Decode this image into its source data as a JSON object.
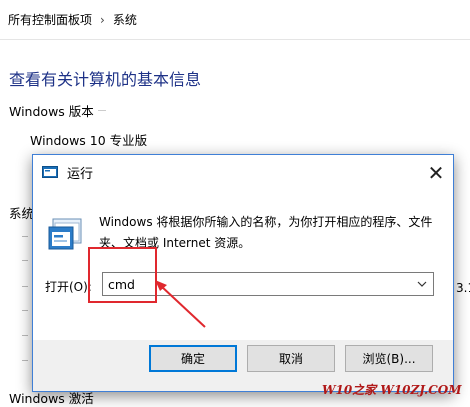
{
  "breadcrumb": {
    "root": "所有控制面板项",
    "separator": "›",
    "current": "系统"
  },
  "page": {
    "title": "查看有关计算机的基本信息",
    "windows_edition_heading": "Windows 版本",
    "edition": "Windows 10 专业版",
    "system_heading_fragment": "系统",
    "number_fragment": "3.1",
    "bottom_heading_fragment": "Windows 激活"
  },
  "run_dialog": {
    "title": "运行",
    "close_glyph": "✕",
    "description": "Windows 将根据你所输入的名称，为你打开相应的程序、文件夹、文档或 Internet 资源。",
    "open_label": "打开(O):",
    "input_value": "cmd",
    "buttons": {
      "ok": "确定",
      "cancel": "取消",
      "browse": "浏览(B)..."
    }
  },
  "watermark": "W10之家 W10ZJ.COM",
  "colors": {
    "title_blue": "#1e3287",
    "annotation_red": "#e0282e",
    "dialog_border": "#3f7fd6",
    "focus_blue": "#0078d7"
  }
}
